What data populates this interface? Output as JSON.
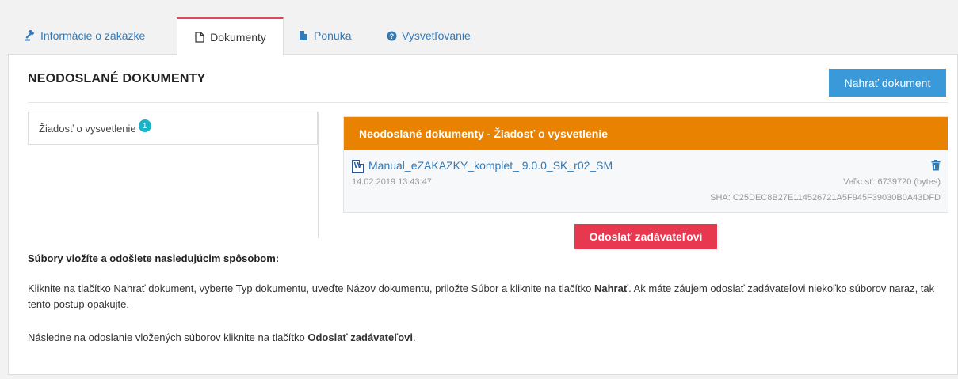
{
  "tabs": [
    {
      "label": "Informácie o zákazke",
      "icon": "gavel-icon"
    },
    {
      "label": "Dokumenty",
      "icon": "document-icon"
    },
    {
      "label": "Ponuka",
      "icon": "file-icon"
    },
    {
      "label": "Vysvetľovanie",
      "icon": "question-circle-icon"
    }
  ],
  "active_tab": "Dokumenty",
  "panel": {
    "title": "NEODOSLANÉ DOKUMENTY",
    "upload_button": "Nahrať dokument"
  },
  "left_list": {
    "items": [
      {
        "label": "Žiadosť o vysvetlenie",
        "badge": "1"
      }
    ]
  },
  "docs": {
    "header": "Neodoslané dokumenty - Žiadosť o vysvetlenie",
    "file": {
      "name": "Manual_eZAKAZKY_komplet_ 9.0.0_SK_r02_SM",
      "date": "14.02.2019 13:43:47",
      "size": "Veľkosť: 6739720 (bytes)",
      "sha": "SHA: C25DEC8B27E114526721A5F945F39030B0A43DFD",
      "icon_letter": "W"
    }
  },
  "send_button": "Odoslať zadávateľovi",
  "instructions": {
    "title": "Súbory vložíte a odošlete nasledujúcim spôsobom:",
    "p1_text": "Kliknite na tlačítko Nahrať dokument, vyberte Typ dokumentu, uveďte Názov dokumentu, priložte Súbor a kliknite na tlačítko ",
    "p1_bold": "Nahrať",
    "p1_tail": ". Ak máte záujem odoslať zadávateľovi niekoľko súborov naraz, tak tento postup opakujte.",
    "p2_text": "Následne na odoslanie vložených súborov kliknite na tlačítko ",
    "p2_bold": "Odoslať zadávateľovi",
    "p2_tail": "."
  },
  "colors": {
    "accent_blue": "#3a99d8",
    "link_blue": "#337ab7",
    "orange_header": "#e98200",
    "send_red": "#e8384f",
    "tab_active_border": "#e0475a",
    "badge_teal": "#1ab2c8"
  }
}
